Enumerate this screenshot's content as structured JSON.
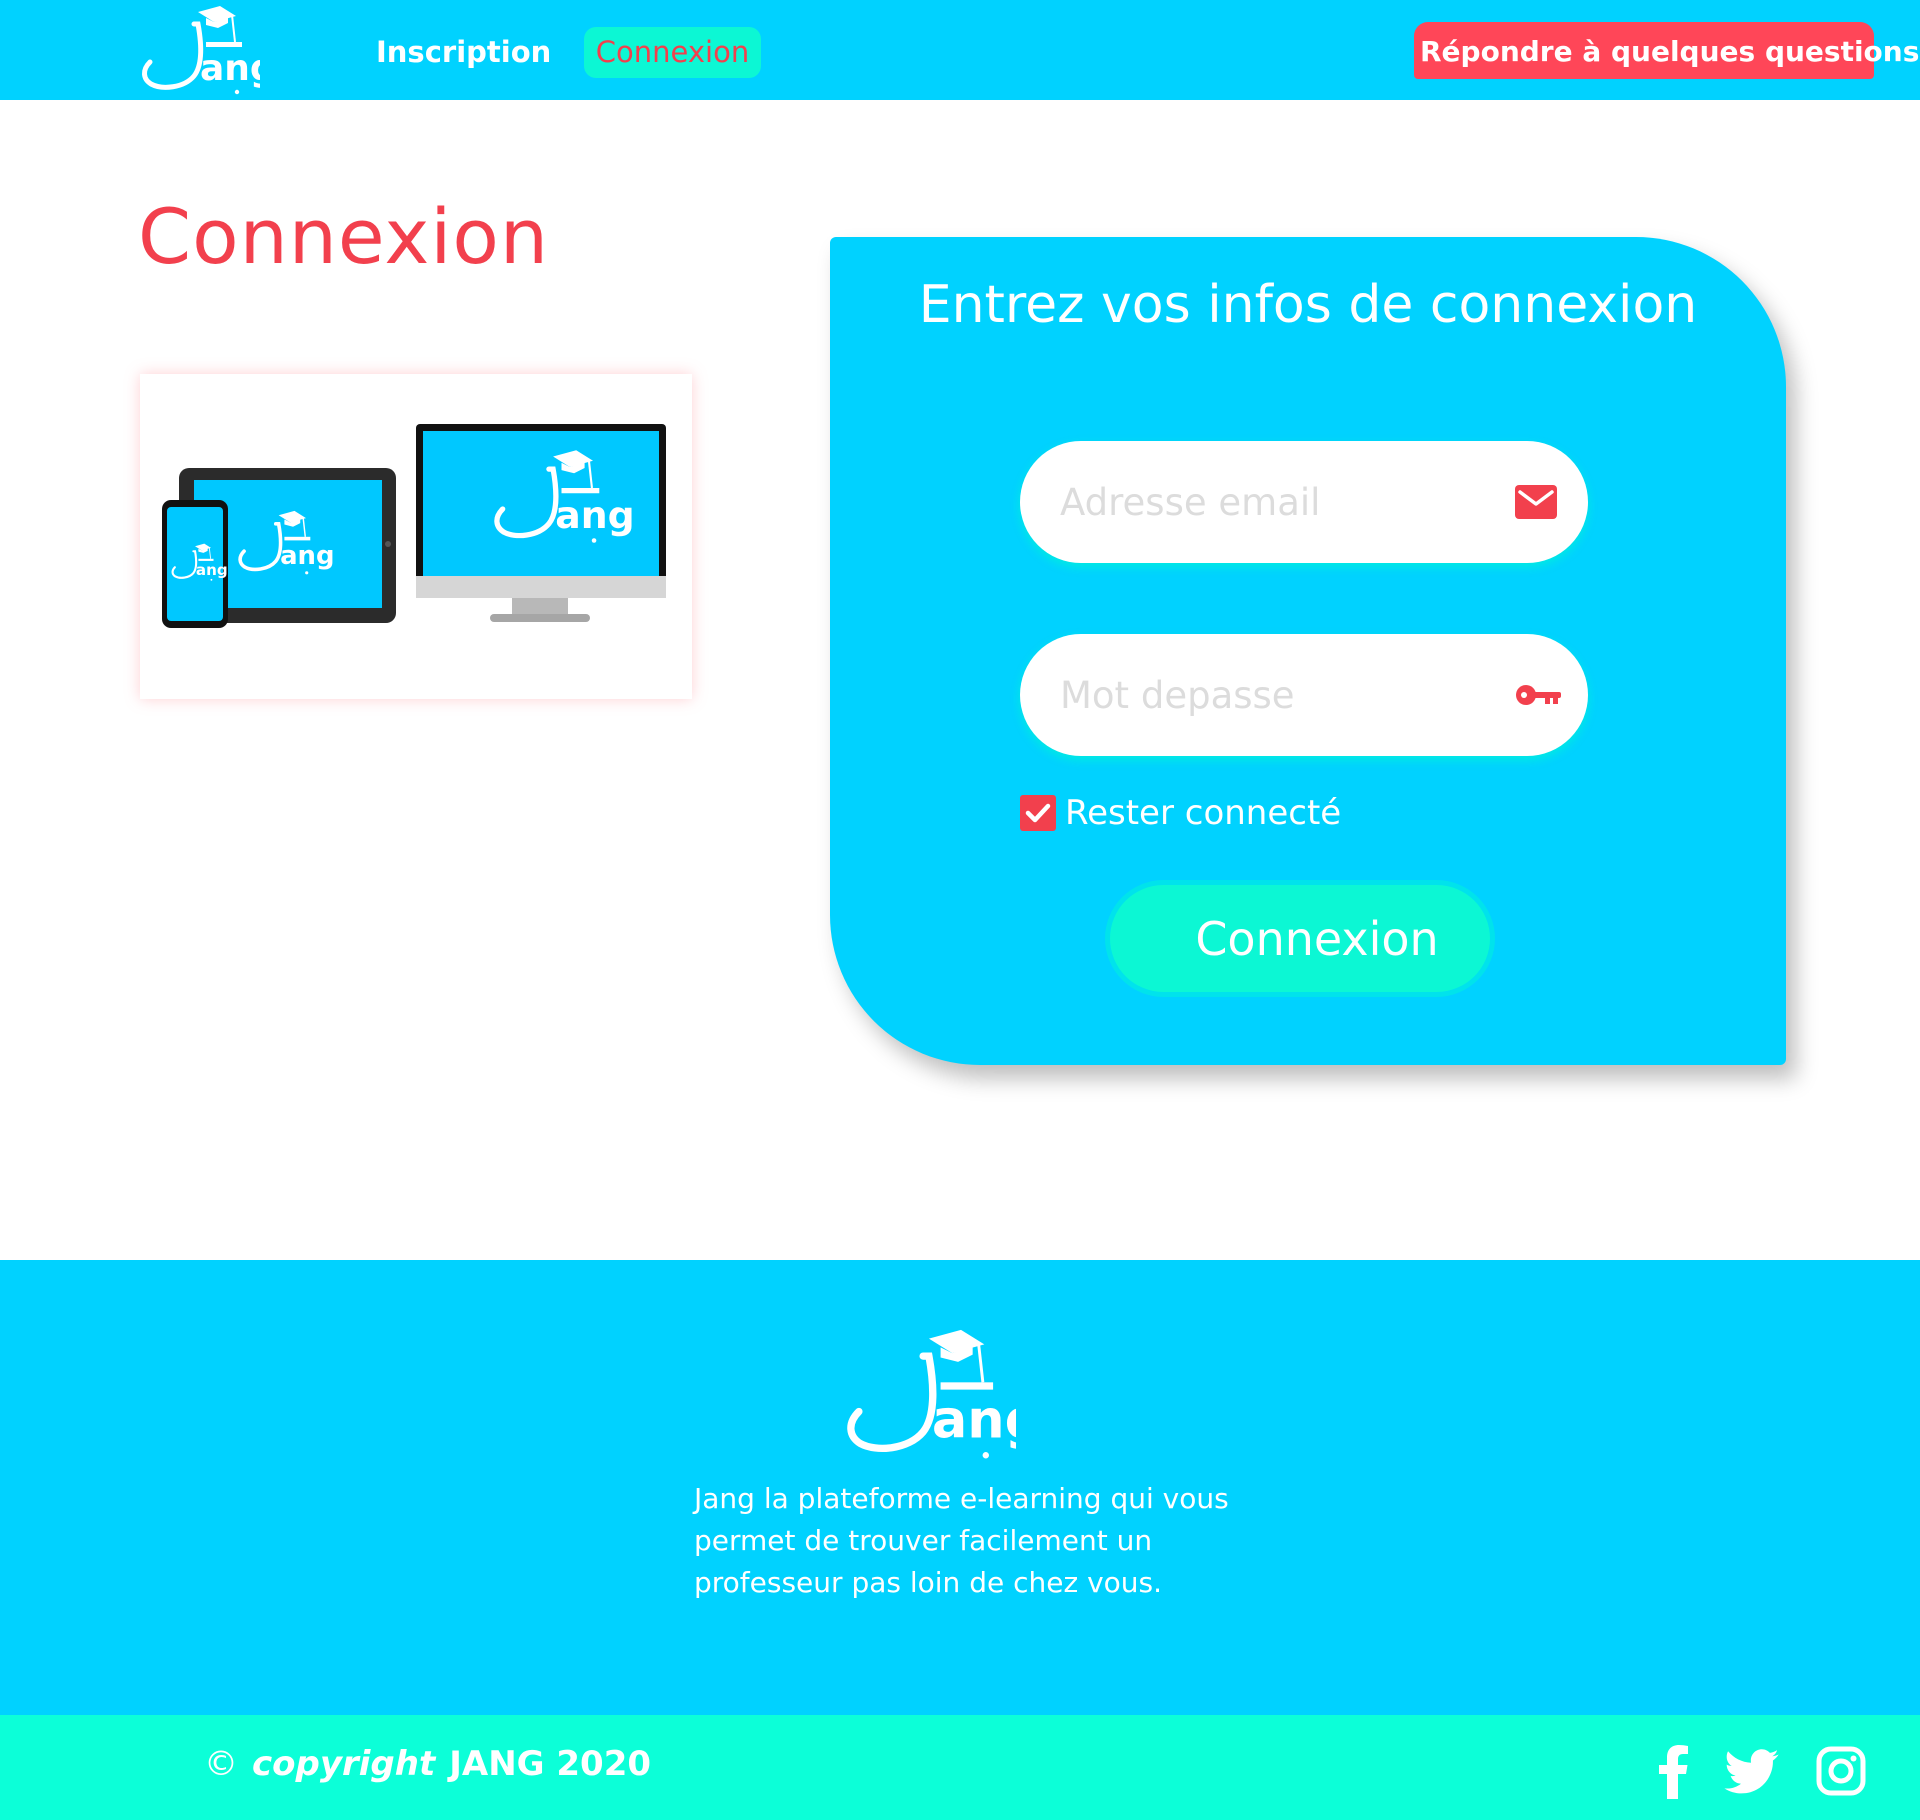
{
  "header": {
    "logo_alt": "Jang",
    "nav": {
      "inscription": "Inscription",
      "connexion": "Connexion"
    },
    "cta": "Répondre à quelques questions"
  },
  "main": {
    "title": "Connexion",
    "illustration_alt": "Jang",
    "login": {
      "heading": "Entrez vos infos de connexion",
      "email_placeholder": "Adresse email",
      "password_placeholder": "Mot depasse",
      "remember_label": "Rester connecté",
      "remember_checked": true,
      "submit_label": "Connexion"
    }
  },
  "footer": {
    "logo_alt": "Jang",
    "description": "Jang la plateforme e-learning qui vous permet de trouver facilement un professeur pas loin de chez vous.",
    "copyright_symbol": "©",
    "copyright_word": "copyright",
    "copyright_rest": "JANG 2020",
    "social_icons": [
      "facebook-icon",
      "twitter-icon",
      "instagram-icon"
    ]
  },
  "colors": {
    "primary": "#00d2ff",
    "accent": "#0cf7d4",
    "danger": "#f2404d",
    "cta": "#ff4658",
    "white": "#ffffff"
  }
}
